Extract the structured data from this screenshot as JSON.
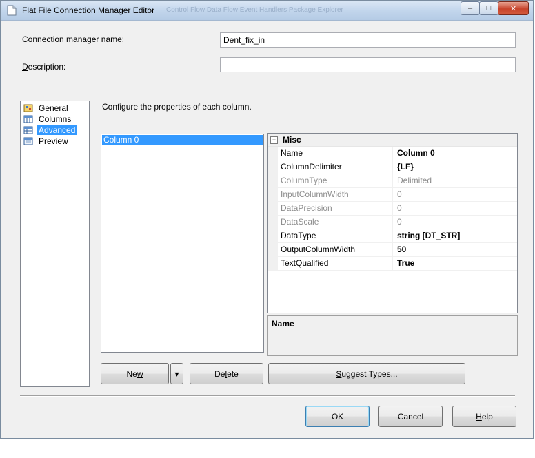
{
  "window": {
    "title": "Flat File Connection Manager Editor",
    "ghost_tabs": "Control Flow     Data Flow     Event Handlers     Package Explorer",
    "minimize": "–",
    "maximize": "□",
    "close": "✕"
  },
  "fields": {
    "name_label_pre": "Connection manager ",
    "name_label_ul": "n",
    "name_label_post": "ame:",
    "name_value": "Dent_fix_in",
    "desc_label_pre": "",
    "desc_label_ul": "D",
    "desc_label_post": "escription:",
    "desc_value": ""
  },
  "nav": {
    "items": [
      {
        "label": "General",
        "icon": "general-icon"
      },
      {
        "label": "Columns",
        "icon": "columns-icon"
      },
      {
        "label": "Advanced",
        "icon": "advanced-icon",
        "selected": true
      },
      {
        "label": "Preview",
        "icon": "preview-icon"
      }
    ]
  },
  "instruction": "Configure the properties of each column.",
  "columns": [
    "Column 0"
  ],
  "grid": {
    "category": "Misc",
    "rows": [
      {
        "name": "Name",
        "value": "Column 0"
      },
      {
        "name": "ColumnDelimiter",
        "value": "{LF}"
      },
      {
        "name": "ColumnType",
        "value": "Delimited"
      },
      {
        "name": "InputColumnWidth",
        "value": "0"
      },
      {
        "name": "DataPrecision",
        "value": "0"
      },
      {
        "name": "DataScale",
        "value": "0"
      },
      {
        "name": "DataType",
        "value": "string [DT_STR]"
      },
      {
        "name": "OutputColumnWidth",
        "value": "50"
      },
      {
        "name": "TextQualified",
        "value": "True"
      }
    ],
    "description_title": "Name"
  },
  "buttons": {
    "new_pre": "Ne",
    "new_ul": "w",
    "new_post": "",
    "dropdown": "▾",
    "delete_pre": "De",
    "delete_ul": "l",
    "delete_post": "ete",
    "suggest_pre": "",
    "suggest_ul": "S",
    "suggest_post": "uggest Types...",
    "ok": "OK",
    "cancel": "Cancel",
    "help_pre": "",
    "help_ul": "H",
    "help_post": "elp"
  },
  "colors": {
    "selection": "#3399ff",
    "dialog_bg": "#f0f0f0",
    "readonly_text": "#8d8d8d"
  }
}
